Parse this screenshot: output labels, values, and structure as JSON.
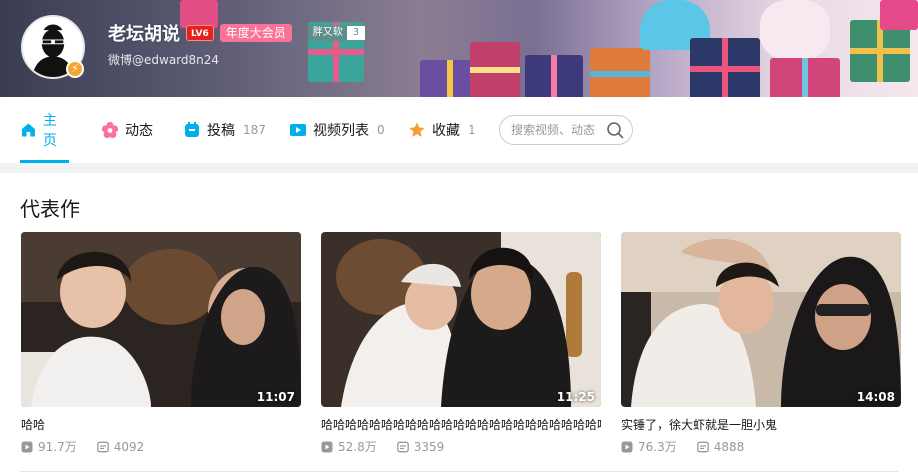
{
  "profile": {
    "name": "老坛胡说",
    "level": "LV6",
    "vip": "年度大会员",
    "medal_name": "胖又软",
    "medal_level": "3",
    "sign": "微博@edward8n24",
    "verify_glyph": "⚡"
  },
  "nav": {
    "home": "主页",
    "dynamic": "动态",
    "uploads": "投稿",
    "uploads_count": "187",
    "series": "视频列表",
    "series_count": "0",
    "favorites": "收藏",
    "favorites_count": "1",
    "search_placeholder": "搜索视频、动态"
  },
  "section": {
    "title": "代表作"
  },
  "videos": [
    {
      "title": "哈哈",
      "duration": "11:07",
      "plays": "91.7万",
      "danmaku": "4092"
    },
    {
      "title": "哈哈哈哈哈哈哈哈哈哈哈哈哈哈哈哈哈哈哈哈哈哈哈哈",
      "duration": "11:25",
      "plays": "52.8万",
      "danmaku": "3359"
    },
    {
      "title": "实锤了，徐大虾就是一胆小鬼",
      "duration": "14:08",
      "plays": "76.3万",
      "danmaku": "4888"
    }
  ],
  "colors": {
    "accent": "#00aeec",
    "vip_pink": "#fb7299",
    "level_red": "#e3211d",
    "muted": "#9499a0"
  },
  "icons": {
    "home": "home-icon",
    "dynamic": "flower-icon",
    "uploads": "upload-icon",
    "series": "playlist-icon",
    "favorites": "star-icon",
    "search": "search-icon",
    "plays": "play-count-icon",
    "danmaku": "danmaku-icon"
  }
}
